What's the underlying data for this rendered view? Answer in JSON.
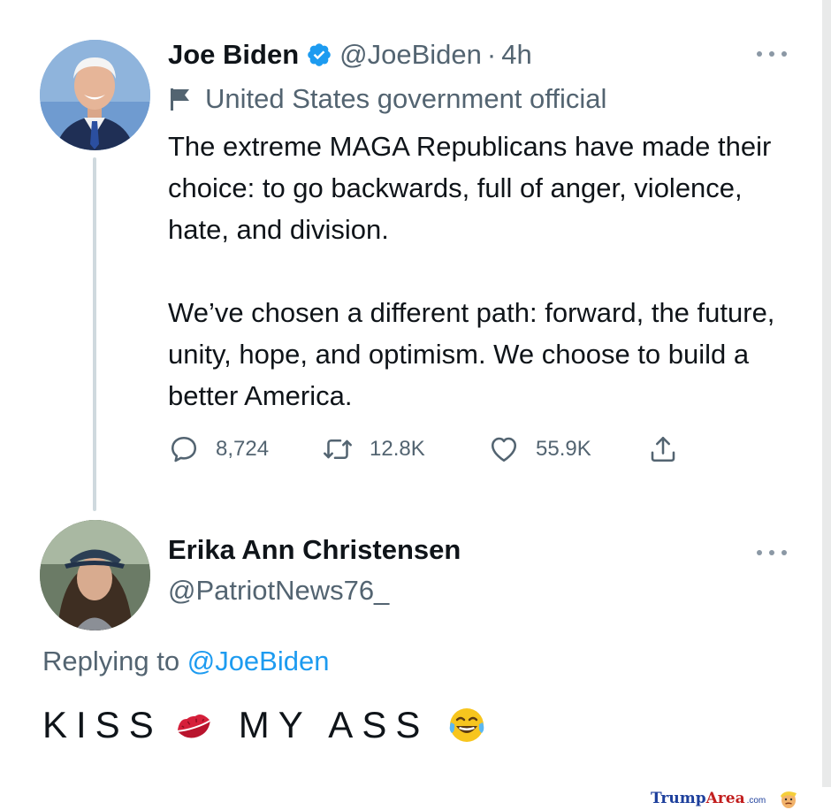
{
  "tweet": {
    "author_name": "Joe Biden",
    "handle": "@JoeBiden",
    "separator": "·",
    "time": "4h",
    "label": "United States government official",
    "paragraphs": [
      "The extreme MAGA Republicans have made their choice: to go backwards, full of anger, violence, hate, and division.",
      "We’ve chosen a different path: forward, the future, unity, hope, and optimism. We choose to build a better America."
    ],
    "stats": {
      "replies": "8,724",
      "retweets": "12.8K",
      "likes": "55.9K"
    },
    "icons": {
      "verified": "verified-badge-icon",
      "label": "flag-icon",
      "reply": "comment-icon",
      "retweet": "retweet-icon",
      "like": "heart-icon",
      "share": "share-icon",
      "more": "more-options-icon"
    }
  },
  "reply": {
    "author_name": "Erika Ann Christensen",
    "handle": "@PatriotNews76_",
    "replying_prefix": "Replying to",
    "replying_to": "@JoeBiden",
    "text_part1": "KISS",
    "text_part2": "MY ASS",
    "emojis": [
      "kiss-mark-icon",
      "tears-of-joy-icon"
    ]
  },
  "watermark": {
    "part1": "Trump",
    "part2": "Area",
    "part3": ".com",
    "icon": "cartoon-face-icon"
  },
  "colors": {
    "link_blue": "#1d9bf0",
    "secondary_text": "#536471",
    "primary_text": "#0f1419",
    "thread_line": "#cfd9de"
  }
}
